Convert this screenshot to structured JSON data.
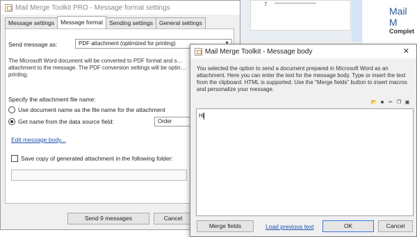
{
  "background": {
    "doc_number": "7",
    "panel_title": "Mail M",
    "panel_subtitle": "Complet"
  },
  "main_window": {
    "title": "Mail Merge Toolkit PRO - Message format settings",
    "tabs": [
      {
        "label": "Message settings",
        "active": false
      },
      {
        "label": "Message format",
        "active": true
      },
      {
        "label": "Sending settings",
        "active": false
      },
      {
        "label": "General settings",
        "active": false
      }
    ],
    "send_as_label": "Send message as:",
    "send_as_value": "PDF attachment (optimized for printing)",
    "pdf_note": "The Microsoft Word document will be converted to PDF format and s… attachment to the message. The PDF conversion settings will be optin… printing.",
    "attachment_name_label": "Specify the attachment file name:",
    "option_doc_name": "Use document name as the file name for the attachment",
    "option_data_source": "Get name from the data source field:",
    "data_source_field": "Order",
    "edit_body_link": "Edit message body...",
    "save_copy_label": "Save copy of generated attachment in the following folder:",
    "folder_path": "",
    "send_button": "Send 9 messages",
    "cancel_button": "Cancel"
  },
  "body_dialog": {
    "title": "Mail Merge Toolkit - Message body",
    "close_glyph": "✕",
    "description": "You selected the option to send a document prepared in Microsoft Word as an attachment. Here you can enter the text for the message body. Type or insert the text from the clipboard. HTML is supported. Use the \"Merge fields\" button to insert macros and personalize your message.",
    "toolbar_icons": [
      "folder-open-icon",
      "save-icon",
      "cut-icon",
      "copy-icon",
      "paste-icon"
    ],
    "editor_text": "Hi",
    "merge_fields_button": "Merge fields",
    "load_previous_link": "Load previous text",
    "ok_button": "OK",
    "cancel_button": "Cancel"
  }
}
